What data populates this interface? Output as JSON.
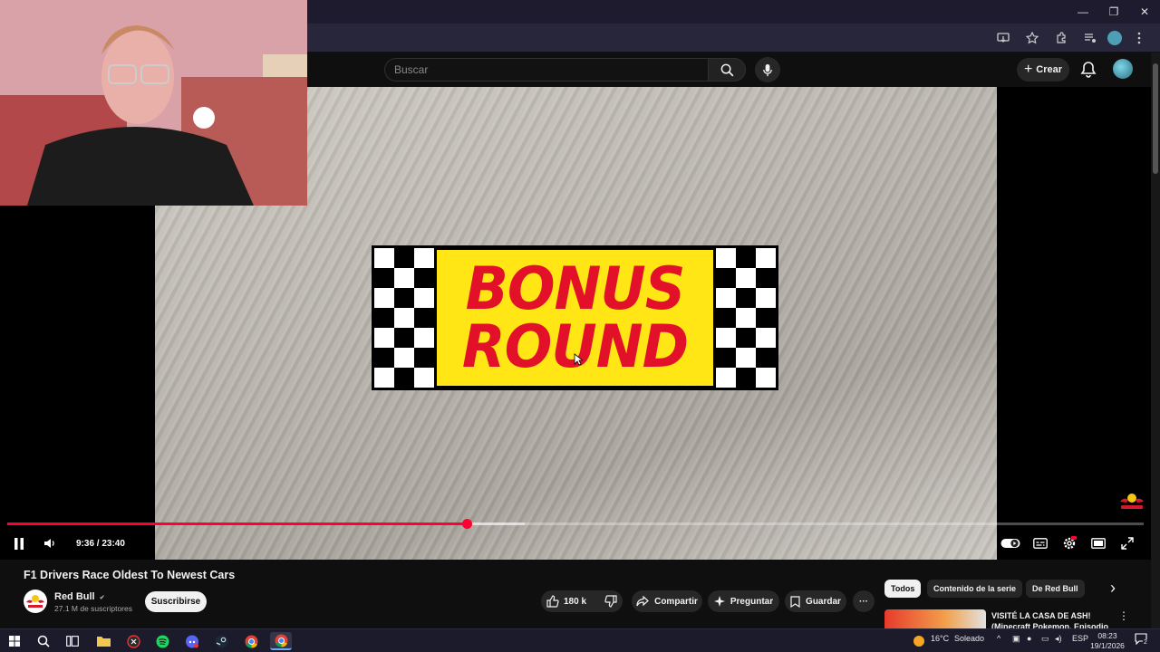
{
  "browser": {
    "window_controls": [
      "—",
      "❐",
      "✕"
    ]
  },
  "header": {
    "search_placeholder": "Buscar",
    "create_label": "Crear"
  },
  "player": {
    "overlay_line1": "BONUS",
    "overlay_line2": "ROUND",
    "time_display": "9:36 / 23:40",
    "played_fraction": 0.404,
    "buffered_fraction": 0.455,
    "progress_color": "#ff0033"
  },
  "video": {
    "title": "F1 Drivers Race Oldest To Newest Cars",
    "channel": "Red Bull",
    "channel_verified": "✔",
    "subscribers": "27.1 M de suscriptores",
    "subscribe_label": "Suscribirse",
    "like_count": "180 k",
    "share_label": "Compartir",
    "ask_label": "Preguntar",
    "save_label": "Guardar",
    "more_label": "···"
  },
  "sidebar": {
    "chips": [
      "Todos",
      "Contenido de la serie",
      "De Red Bull"
    ],
    "next_label": "›",
    "recommendation_title": "VISITÉ LA CASA DE ASH! (Minecraft Pokemon, Episodio",
    "rec_menu": "⋮"
  },
  "taskbar": {
    "weather_temp": "16°C",
    "weather_text": "Soleado",
    "language": "ESP",
    "time": "08:23",
    "date": "19/1/2026",
    "notifications_count": "2"
  },
  "colors": {
    "accent_red": "#ff0033",
    "bonus_yellow": "#ffe614",
    "bonus_red": "#e3102a",
    "background": "#0f0f0f"
  }
}
